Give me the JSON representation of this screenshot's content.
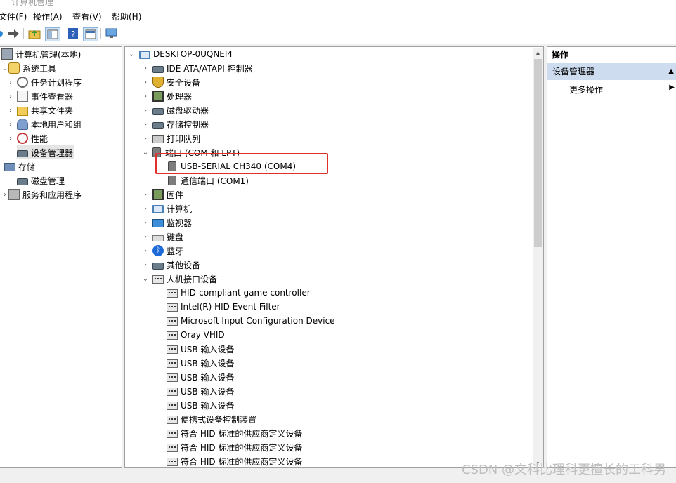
{
  "window": {
    "title": "计算机管理"
  },
  "menu": [
    "文件(F)",
    "操作(A)",
    "查看(V)",
    "帮助(H)"
  ],
  "left_tree": {
    "root": "计算机管理(本地)",
    "items": [
      {
        "label": "系统工具",
        "level": 1,
        "expanded": true,
        "icon": "tools-icon"
      },
      {
        "label": "任务计划程序",
        "level": 2,
        "icon": "clock-icon"
      },
      {
        "label": "事件查看器",
        "level": 2,
        "icon": "event-viewer-icon"
      },
      {
        "label": "共享文件夹",
        "level": 2,
        "icon": "shared-folder-icon"
      },
      {
        "label": "本地用户和组",
        "level": 2,
        "icon": "users-icon"
      },
      {
        "label": "性能",
        "level": 2,
        "icon": "performance-icon"
      },
      {
        "label": "设备管理器",
        "level": 2,
        "icon": "device-manager-icon",
        "selected": true
      },
      {
        "label": "存储",
        "level": 1,
        "expanded": true,
        "icon": "storage-icon"
      },
      {
        "label": "磁盘管理",
        "level": 2,
        "icon": "disk-icon"
      },
      {
        "label": "服务和应用程序",
        "level": 1,
        "icon": "services-icon"
      }
    ]
  },
  "device_tree": {
    "root": "DESKTOP-0UQNEI4",
    "categories": [
      {
        "label": "IDE ATA/ATAPI 控制器",
        "expanded": false
      },
      {
        "label": "安全设备",
        "expanded": false
      },
      {
        "label": "处理器",
        "expanded": false
      },
      {
        "label": "磁盘驱动器",
        "expanded": false
      },
      {
        "label": "存储控制器",
        "expanded": false
      },
      {
        "label": "打印队列",
        "expanded": false
      },
      {
        "label": "端口 (COM 和 LPT)",
        "expanded": true
      },
      {
        "label": "USB-SERIAL CH340 (COM4)",
        "child": true,
        "highlighted": true
      },
      {
        "label": "通信端口 (COM1)",
        "child": true
      },
      {
        "label": "固件",
        "expanded": false
      },
      {
        "label": "计算机",
        "expanded": false
      },
      {
        "label": "监视器",
        "expanded": false
      },
      {
        "label": "键盘",
        "expanded": false
      },
      {
        "label": "蓝牙",
        "expanded": false
      },
      {
        "label": "其他设备",
        "expanded": false
      },
      {
        "label": "人机接口设备",
        "expanded": true
      },
      {
        "label": "HID-compliant game controller",
        "child": true
      },
      {
        "label": "Intel(R) HID Event Filter",
        "child": true
      },
      {
        "label": "Microsoft Input Configuration Device",
        "child": true
      },
      {
        "label": "Oray VHID",
        "child": true
      },
      {
        "label": "USB 输入设备",
        "child": true
      },
      {
        "label": "USB 输入设备",
        "child": true
      },
      {
        "label": "USB 输入设备",
        "child": true
      },
      {
        "label": "USB 输入设备",
        "child": true
      },
      {
        "label": "USB 输入设备",
        "child": true
      },
      {
        "label": "便携式设备控制装置",
        "child": true
      },
      {
        "label": "符合 HID 标准的供应商定义设备",
        "child": true
      },
      {
        "label": "符合 HID 标准的供应商定义设备",
        "child": true
      },
      {
        "label": "符合 HID 标准的供应商定义设备",
        "child": true
      }
    ]
  },
  "actions": {
    "header": "操作",
    "section": "设备管理器",
    "more": "更多操作"
  },
  "watermark": "CSDN @文科比理科更擅长的工科男"
}
